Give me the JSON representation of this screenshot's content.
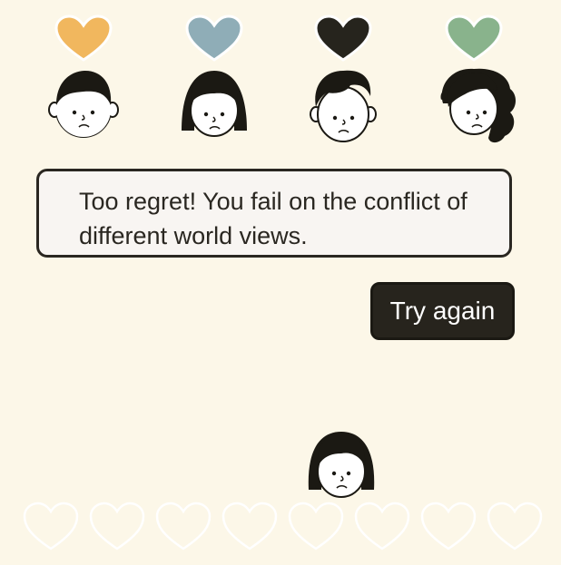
{
  "characters": [
    {
      "name": "character-1",
      "heart_color": "#f1b75e",
      "hair": "short"
    },
    {
      "name": "character-2",
      "heart_color": "#8fadb7",
      "hair": "bob"
    },
    {
      "name": "character-3",
      "heart_color": "#26241d",
      "hair": "quiff"
    },
    {
      "name": "character-4",
      "heart_color": "#89b38c",
      "hair": "curly"
    }
  ],
  "message": {
    "text": "Too regret! You fail on the conflict of different world views."
  },
  "button": {
    "label": "Try again"
  },
  "player": {
    "mood": "sad"
  },
  "lives": {
    "count": 8,
    "filled": 0,
    "color": "#ffffff"
  }
}
